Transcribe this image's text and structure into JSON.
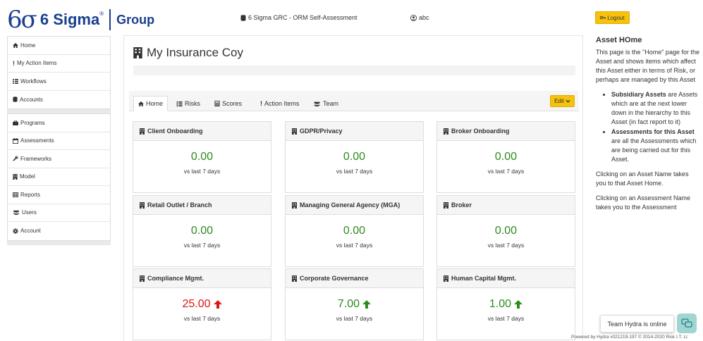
{
  "brand": {
    "mark": "6σ",
    "word": "6 Sigma",
    "reg": "®",
    "group": "Group"
  },
  "header": {
    "app_title": "6 Sigma GRC - ORM Self-Assessment",
    "user": "abc",
    "logout": "Logout"
  },
  "sidebar": {
    "group1": [
      {
        "icon": "home-icon",
        "label": "Home"
      },
      {
        "icon": "exclamation-icon",
        "label": "My Action Items"
      },
      {
        "icon": "list-icon",
        "label": "Workflows"
      },
      {
        "icon": "database-icon",
        "label": "Accounts"
      }
    ],
    "group2": [
      {
        "icon": "briefcase-icon",
        "label": "Programs"
      },
      {
        "icon": "calendar-icon",
        "label": "Assessments"
      },
      {
        "icon": "wrench-icon",
        "label": "Frameworks"
      },
      {
        "icon": "building-icon",
        "label": "Model"
      },
      {
        "icon": "table-icon",
        "label": "Reports"
      },
      {
        "icon": "users-icon",
        "label": "Users"
      },
      {
        "icon": "gear-icon",
        "label": "Account"
      }
    ]
  },
  "main": {
    "title": "My Insurance Coy",
    "tabs": [
      {
        "label": "Home",
        "icon": "home-icon",
        "active": true
      },
      {
        "label": "Risks",
        "icon": "list-icon",
        "active": false
      },
      {
        "label": "Scores",
        "icon": "calculator-icon",
        "active": false
      },
      {
        "label": "Action Items",
        "icon": "exclamation-icon",
        "active": false
      },
      {
        "label": "Team",
        "icon": "users-icon",
        "active": false
      }
    ],
    "edit_label": "Edit",
    "cards": [
      {
        "title": "Client Onboarding",
        "value": "0.00",
        "sub": "vs last 7 days",
        "trend": "none"
      },
      {
        "title": "GDPR/Privacy",
        "value": "0.00",
        "sub": "vs last 7 days",
        "trend": "none"
      },
      {
        "title": "Broker Onboarding",
        "value": "0.00",
        "sub": "vs last 7 days",
        "trend": "none"
      },
      {
        "title": "Retail Outlet / Branch",
        "value": "0.00",
        "sub": "vs last 7 days",
        "trend": "none"
      },
      {
        "title": "Managing General Agency (MGA)",
        "value": "0.00",
        "sub": "vs last 7 days",
        "trend": "none"
      },
      {
        "title": "Broker",
        "value": "0.00",
        "sub": "vs last 7 days",
        "trend": "none"
      },
      {
        "title": "Compliance Mgmt.",
        "value": "25.00",
        "sub": "vs last 7 days",
        "trend": "up-red"
      },
      {
        "title": "Corporate Governance",
        "value": "7.00",
        "sub": "vs last 7 days",
        "trend": "up-green"
      },
      {
        "title": "Human Capital Mgmt.",
        "value": "1.00",
        "sub": "vs last 7 days",
        "trend": "up-green"
      }
    ]
  },
  "help": {
    "title": "Asset HOme",
    "intro": "This page is the \"Home\" page for the Asset and shows items which affect this Asset either in terms of Risk, or perhaps are managed by this Asset",
    "bullets": [
      {
        "bold": "Subsidiary Assets",
        "text": " are Assets which are at the next lower down in the hierarchy to this Asset (in fact report to it)"
      },
      {
        "bold": "Assessments for this Asset",
        "text": " are all the Assessments which are being carried out for this Asset."
      }
    ],
    "p2": "Clicking on an Asset Name takes you to that Asset Home.",
    "p3": "Clicking on an Assessment Name takes you to the Assessment"
  },
  "chat": {
    "text": "Team Hydra is online"
  },
  "footer": {
    "powered": "Powered by Hydra v021219-197 © 2014-2020 Risk I.T. Lt"
  },
  "colors": {
    "accent": "#f6c20d",
    "brand": "#1a3f8f",
    "up_green": "#2e8b1e",
    "up_red": "#e01414",
    "chat_teal": "#9fd6d2"
  }
}
